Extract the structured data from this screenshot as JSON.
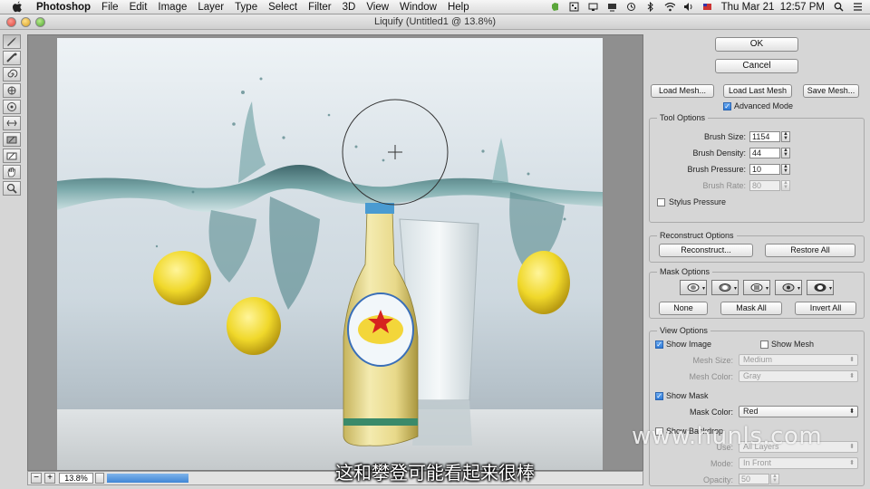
{
  "menubar": {
    "app": "Photoshop",
    "items": [
      "File",
      "Edit",
      "Image",
      "Layer",
      "Type",
      "Select",
      "Filter",
      "3D",
      "View",
      "Window",
      "Help"
    ],
    "clock": "Thu Mar 21  12:57 PM",
    "icons": [
      "apple-icon",
      "evernote-icon",
      "grid-icon",
      "monitor-icon",
      "display-icon",
      "time-machine-icon",
      "bluetooth-icon",
      "wifi-icon",
      "volume-icon",
      "flag-icon",
      "spotlight-icon",
      "list-icon"
    ]
  },
  "window": {
    "title": "Liquify (Untitled1 @ 13.8%)"
  },
  "tools": [
    "forward-warp-icon",
    "reconstruct-icon",
    "twirl-icon",
    "pucker-icon",
    "bloat-icon",
    "push-left-icon",
    "freeze-mask-icon",
    "thaw-mask-icon",
    "hand-icon",
    "zoom-icon"
  ],
  "bottom": {
    "zoom_out": "−",
    "zoom_in": "+",
    "zoom_value": "13.8%"
  },
  "panel": {
    "ok": "OK",
    "cancel": "Cancel",
    "load_mesh": "Load Mesh...",
    "load_last_mesh": "Load Last Mesh",
    "save_mesh": "Save Mesh...",
    "advanced_mode": "Advanced Mode",
    "tool_options": {
      "title": "Tool Options",
      "brush_size_label": "Brush Size:",
      "brush_size": "1154",
      "brush_density_label": "Brush Density:",
      "brush_density": "44",
      "brush_pressure_label": "Brush Pressure:",
      "brush_pressure": "10",
      "brush_rate_label": "Brush Rate:",
      "brush_rate": "80",
      "stylus_pressure": "Stylus Pressure"
    },
    "reconstruct_options": {
      "title": "Reconstruct Options",
      "reconstruct": "Reconstruct...",
      "restore_all": "Restore All"
    },
    "mask_options": {
      "title": "Mask Options",
      "none": "None",
      "mask_all": "Mask All",
      "invert_all": "Invert All"
    },
    "view_options": {
      "title": "View Options",
      "show_image": "Show Image",
      "show_mesh": "Show Mesh",
      "mesh_size_label": "Mesh Size:",
      "mesh_size": "Medium",
      "mesh_color_label": "Mesh Color:",
      "mesh_color": "Gray",
      "show_mask": "Show Mask",
      "mask_color_label": "Mask Color:",
      "mask_color": "Red",
      "show_backdrop": "Show Backdrop",
      "use_label": "Use:",
      "use_value": "All Layers",
      "mode_label": "Mode:",
      "mode_value": "In Front",
      "opacity_label": "Opacity:",
      "opacity": "50"
    }
  },
  "overlay": {
    "watermark": "www.hunls.com",
    "subtitle": "这和攀登可能看起来很棒"
  },
  "colors": {
    "accent_blue": "#3f86d6",
    "panel_bg": "#d6d6d6"
  }
}
